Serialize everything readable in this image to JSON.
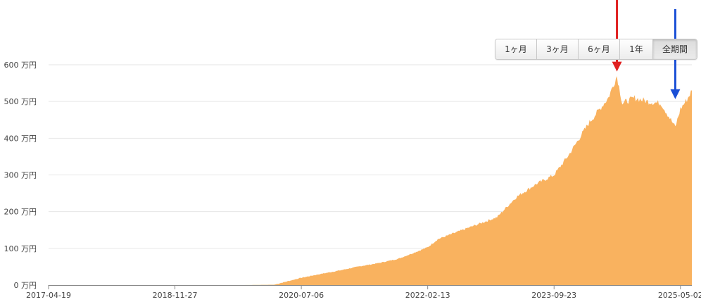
{
  "range_selector": {
    "buttons": [
      "1ヶ月",
      "3ヶ月",
      "6ヶ月",
      "1年",
      "全期間"
    ],
    "active": "全期間"
  },
  "chart_data": {
    "type": "area",
    "title": "",
    "xlabel": "",
    "ylabel": "",
    "unit": "万円",
    "x_start": "2017-04-19",
    "x_end": "2025-06-24",
    "ylim": [
      0,
      600
    ],
    "y_ticks": [
      0,
      100,
      200,
      300,
      400,
      500,
      600
    ],
    "y_tick_labels": [
      "0 万円",
      "100 万円",
      "200 万円",
      "300 万円",
      "400 万円",
      "500 万円",
      "600 万円"
    ],
    "x_tick_labels": [
      "2017-04-19",
      "2018-11-27",
      "2020-07-06",
      "2022-02-13",
      "2023-09-23",
      "2025-05-02"
    ],
    "grid": true,
    "color": "#f9b25f",
    "series": [
      {
        "x": [
          "2017-04-19",
          "2019-04-01",
          "2019-10-01",
          "2020-03-01",
          "2020-07-06",
          "2020-10-01",
          "2021-01-01",
          "2021-04-01",
          "2021-07-01",
          "2021-10-01",
          "2022-01-01",
          "2022-02-13",
          "2022-04-01",
          "2022-07-01",
          "2022-10-01",
          "2023-01-01",
          "2023-04-01",
          "2023-07-01",
          "2023-09-23",
          "2023-12-01",
          "2024-03-01",
          "2024-06-01",
          "2024-07-11",
          "2024-08-05",
          "2024-10-01",
          "2024-12-01",
          "2025-02-01",
          "2025-04-08",
          "2025-05-02",
          "2025-06-01",
          "2025-06-24"
        ],
        "values": [
          0,
          0,
          0,
          1,
          20,
          30,
          40,
          51,
          60,
          72,
          93,
          103,
          125,
          145,
          165,
          185,
          240,
          275,
          300,
          355,
          440,
          510,
          570,
          495,
          510,
          500,
          495,
          430,
          480,
          505,
          530
        ]
      }
    ],
    "annotations": [
      {
        "type": "arrow",
        "color": "#e02020",
        "x": "2024-07-11",
        "y": 570
      },
      {
        "type": "arrow",
        "color": "#1a4fd6",
        "x": "2025-04-08",
        "y": 495
      }
    ]
  }
}
